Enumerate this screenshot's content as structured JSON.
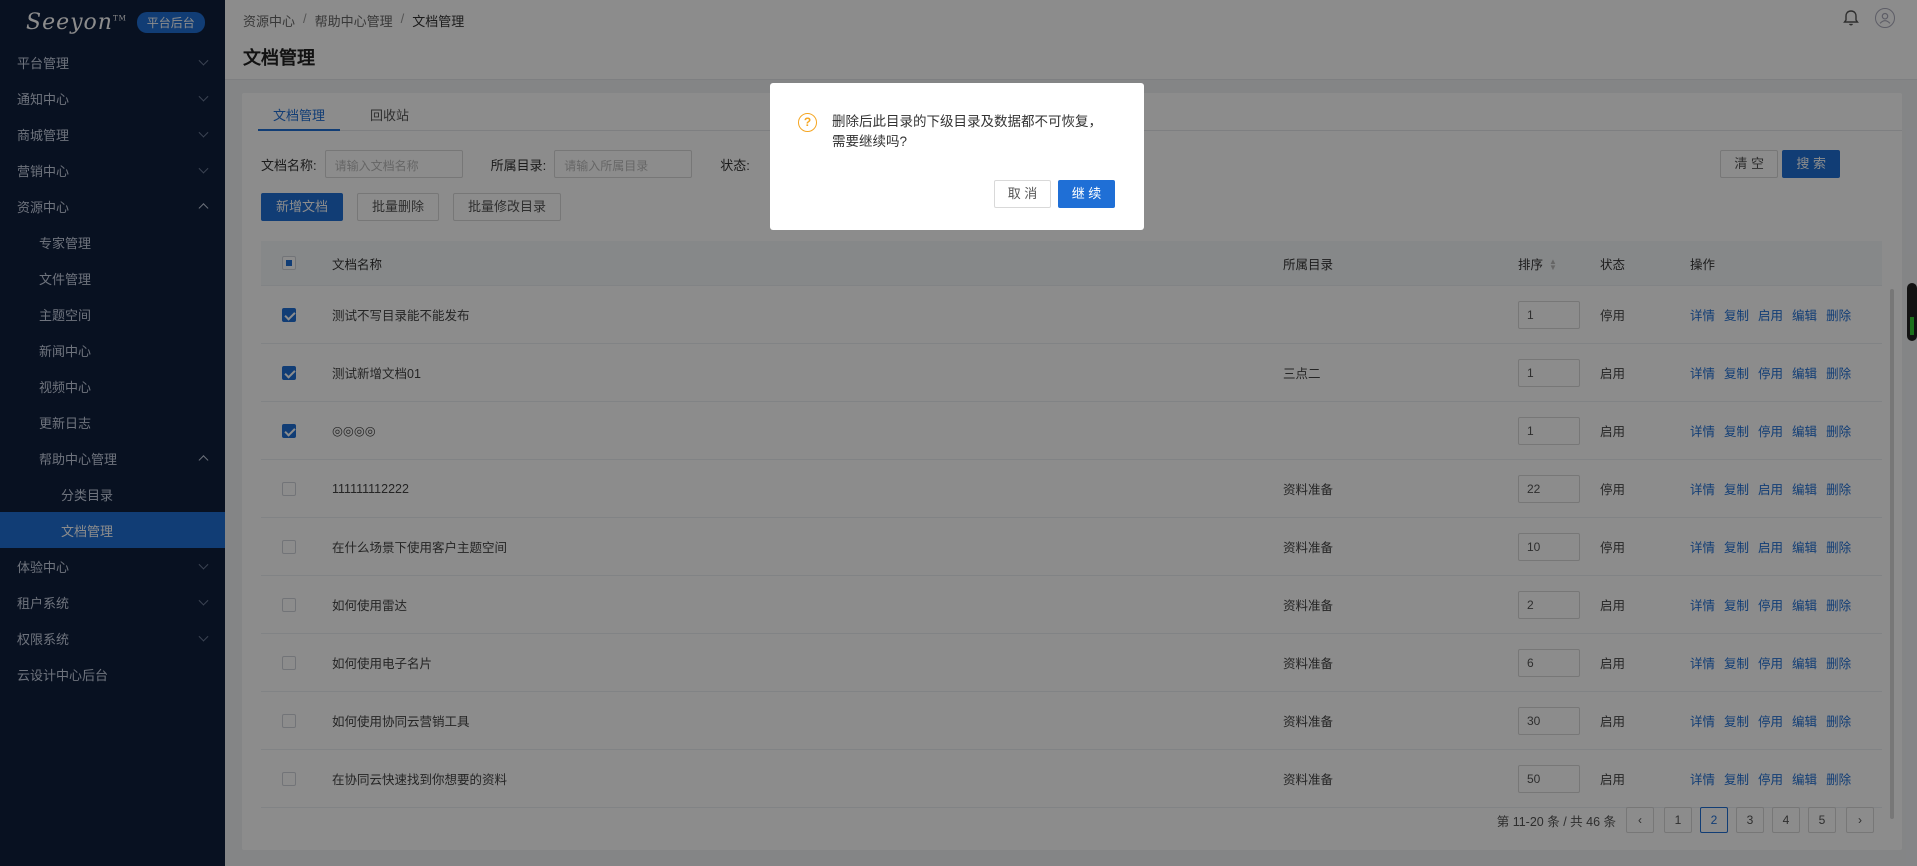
{
  "brand": {
    "logo": "Seeyon",
    "badge": "平台后台"
  },
  "sidebar": {
    "items": [
      {
        "label": "平台管理",
        "level": 1,
        "arrow": "down"
      },
      {
        "label": "通知中心",
        "level": 1,
        "arrow": "down"
      },
      {
        "label": "商城管理",
        "level": 1,
        "arrow": "down"
      },
      {
        "label": "营销中心",
        "level": 1,
        "arrow": "down"
      },
      {
        "label": "资源中心",
        "level": 1,
        "arrow": "up"
      },
      {
        "label": "专家管理",
        "level": 2
      },
      {
        "label": "文件管理",
        "level": 2
      },
      {
        "label": "主题空间",
        "level": 2
      },
      {
        "label": "新闻中心",
        "level": 2
      },
      {
        "label": "视频中心",
        "level": 2
      },
      {
        "label": "更新日志",
        "level": 2
      },
      {
        "label": "帮助中心管理",
        "level": 2,
        "arrow": "up"
      },
      {
        "label": "分类目录",
        "level": 3
      },
      {
        "label": "文档管理",
        "level": 3,
        "active": true
      },
      {
        "label": "体验中心",
        "level": 1,
        "arrow": "down"
      },
      {
        "label": "租户系统",
        "level": 1,
        "arrow": "down"
      },
      {
        "label": "权限系统",
        "level": 1,
        "arrow": "down"
      },
      {
        "label": "云设计中心后台",
        "level": 1
      }
    ]
  },
  "header": {
    "breadcrumb": [
      "资源中心",
      "帮助中心管理",
      "文档管理"
    ],
    "title": "文档管理",
    "icons": [
      "bell-icon",
      "user-icon"
    ]
  },
  "tabs": [
    "文档管理",
    "回收站"
  ],
  "filter": {
    "name_label": "文档名称:",
    "name_placeholder": "请输入文档名称",
    "dir_label": "所属目录:",
    "dir_placeholder": "请输入所属目录",
    "status_label": "状态:",
    "clear": "清 空",
    "search": "搜 索"
  },
  "actions": {
    "add": "新增文档",
    "batch_delete": "批量删除",
    "batch_move": "批量修改目录"
  },
  "table": {
    "headers": {
      "name": "文档名称",
      "dir": "所属目录",
      "sort": "排序",
      "status": "状态",
      "ops": "操作"
    },
    "rows": [
      {
        "checked": true,
        "name": "测试不写目录能不能发布",
        "dir": "",
        "sort": "1",
        "status": "停用",
        "ops": [
          "详情",
          "复制",
          "启用",
          "编辑",
          "删除"
        ]
      },
      {
        "checked": true,
        "name": "测试新增文档01",
        "dir": "三点二",
        "sort": "1",
        "status": "启用",
        "ops": [
          "详情",
          "复制",
          "停用",
          "编辑",
          "删除"
        ]
      },
      {
        "checked": true,
        "name": "◎◎◎◎",
        "dir": "",
        "sort": "1",
        "status": "启用",
        "ops": [
          "详情",
          "复制",
          "停用",
          "编辑",
          "删除"
        ]
      },
      {
        "checked": false,
        "name": "111111112222",
        "dir": "资料准备",
        "sort": "22",
        "status": "停用",
        "ops": [
          "详情",
          "复制",
          "启用",
          "编辑",
          "删除"
        ]
      },
      {
        "checked": false,
        "name": "在什么场景下使用客户主题空间",
        "dir": "资料准备",
        "sort": "10",
        "status": "停用",
        "ops": [
          "详情",
          "复制",
          "启用",
          "编辑",
          "删除"
        ]
      },
      {
        "checked": false,
        "name": "如何使用雷达",
        "dir": "资料准备",
        "sort": "2",
        "status": "启用",
        "ops": [
          "详情",
          "复制",
          "停用",
          "编辑",
          "删除"
        ]
      },
      {
        "checked": false,
        "name": "如何使用电子名片",
        "dir": "资料准备",
        "sort": "6",
        "status": "启用",
        "ops": [
          "详情",
          "复制",
          "停用",
          "编辑",
          "删除"
        ]
      },
      {
        "checked": false,
        "name": "如何使用协同云营销工具",
        "dir": "资料准备",
        "sort": "30",
        "status": "启用",
        "ops": [
          "详情",
          "复制",
          "停用",
          "编辑",
          "删除"
        ]
      },
      {
        "checked": false,
        "name": "在协同云快速找到你想要的资料",
        "dir": "资料准备",
        "sort": "50",
        "status": "启用",
        "ops": [
          "详情",
          "复制",
          "停用",
          "编辑",
          "删除"
        ]
      }
    ]
  },
  "pagination": {
    "summary": "第 11-20 条 / 共 46 条",
    "pages": [
      "1",
      "2",
      "3",
      "4",
      "5"
    ],
    "current": "2",
    "prev": "‹",
    "next": "›"
  },
  "dialog": {
    "icon": "question-icon",
    "message": "删除后此目录的下级目录及数据都不可恢复，需要继续吗?",
    "cancel": "取 消",
    "ok": "继 续"
  },
  "colors": {
    "accent": "#1f6fd6",
    "sidebar": "#0f1f3d",
    "warning": "#f5a623"
  }
}
